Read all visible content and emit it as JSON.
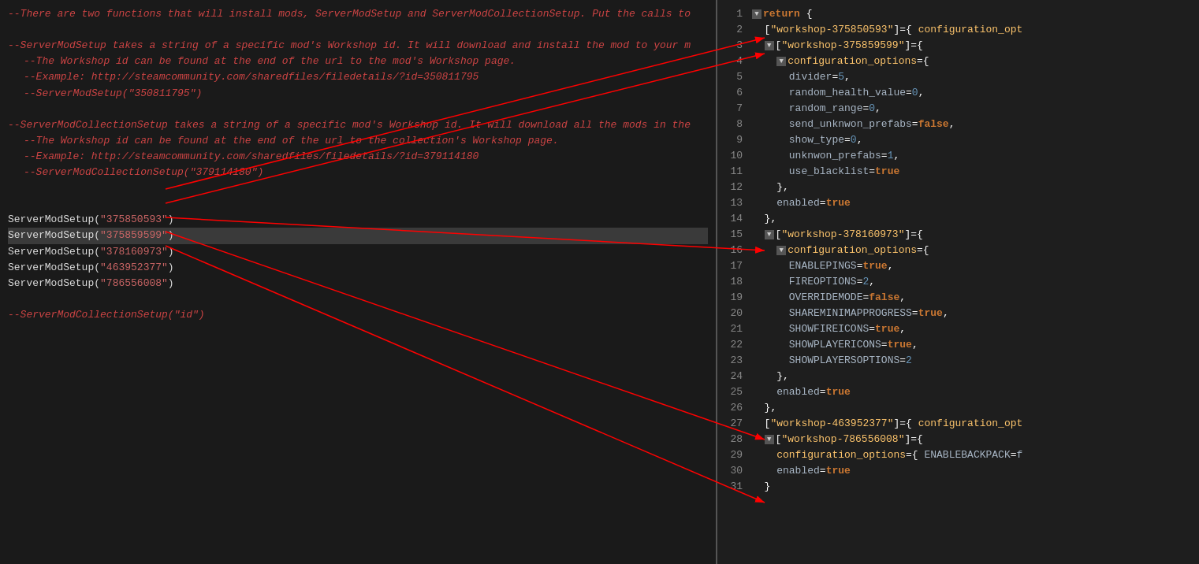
{
  "left_panel": {
    "comments": [
      "--There are two functions that will install mods, ServerModSetup and ServerModCollectionSetup. Put the calls to",
      "",
      "--ServerModSetup takes a string of a specific mod's Workshop id. It will download and install the mod to your m",
      "  --The Workshop id can be found at the end of the url to the mod's Workshop page.",
      "  --Example: http://steamcommunity.com/sharedfiles/filedetails/?id=350811795",
      "  --ServerModSetup(\"350811795\")",
      "",
      "--ServerModCollectionSetup takes a string of a specific mod's Workshop id. It will download all the mods in the",
      "  --The Workshop id can be found at the end of the url to the collection's Workshop page.",
      "  --Example: http://steamcommunity.com/sharedfiles/filedetails/?id=379114180",
      "  --ServerModCollectionSetup(\"379114180\")"
    ],
    "code_lines": [
      "ServerModSetup(\"375850593\")",
      "ServerModSetup(\"375859599\")",
      "ServerModSetup(\"378160973\")",
      "ServerModSetup(\"463952377\")",
      "ServerModSetup(\"786556008\")",
      "",
      "--ServerModCollectionSetup(\"id\")"
    ]
  },
  "right_panel": {
    "lines": [
      {
        "num": 1,
        "content": "return {"
      },
      {
        "num": 2,
        "content": "  [\"workshop-375850593\"]={ configuration_opt"
      },
      {
        "num": 3,
        "content": "  [\"workshop-375859599\"]={"
      },
      {
        "num": 4,
        "content": "    configuration_options={"
      },
      {
        "num": 5,
        "content": "      divider=5,"
      },
      {
        "num": 6,
        "content": "      random_health_value=0,"
      },
      {
        "num": 7,
        "content": "      random_range=0,"
      },
      {
        "num": 8,
        "content": "      send_unknwon_prefabs=false,"
      },
      {
        "num": 9,
        "content": "      show_type=0,"
      },
      {
        "num": 10,
        "content": "      unknwon_prefabs=1,"
      },
      {
        "num": 11,
        "content": "      use_blacklist=true"
      },
      {
        "num": 12,
        "content": "    },"
      },
      {
        "num": 13,
        "content": "    enabled=true"
      },
      {
        "num": 14,
        "content": "  },"
      },
      {
        "num": 15,
        "content": "  [\"workshop-378160973\"]={"
      },
      {
        "num": 16,
        "content": "    configuration_options={"
      },
      {
        "num": 17,
        "content": "      ENABLEPINGS=true,"
      },
      {
        "num": 18,
        "content": "      FIREOPTIONS=2,"
      },
      {
        "num": 19,
        "content": "      OVERRIDEMODE=false,"
      },
      {
        "num": 20,
        "content": "      SHAREMINIMAPPROGRESS=true,"
      },
      {
        "num": 21,
        "content": "      SHOWFIREICONS=true,"
      },
      {
        "num": 22,
        "content": "      SHOWPLAYERICONS=true,"
      },
      {
        "num": 23,
        "content": "      SHOWPLAYERSOPTIONS=2"
      },
      {
        "num": 24,
        "content": "    },"
      },
      {
        "num": 25,
        "content": "    enabled=true"
      },
      {
        "num": 26,
        "content": "  },"
      },
      {
        "num": 27,
        "content": "  [\"workshop-463952377\"]={ configuration_opt"
      },
      {
        "num": 28,
        "content": "  [\"workshop-786556008\"]={"
      },
      {
        "num": 29,
        "content": "    configuration_options={ ENABLEBACKPACK=f"
      },
      {
        "num": 30,
        "content": "    enabled=true"
      },
      {
        "num": 31,
        "content": "  }"
      }
    ]
  },
  "colors": {
    "comment": "#cc4444",
    "keyword": "#cc7832",
    "property": "#a9b7c6",
    "workshop_key": "#ffc66d",
    "number": "#6897bb",
    "background_left": "#1a1a1a",
    "background_right": "#1e1e1e",
    "line_num": "#888888",
    "arrow": "#ff0000"
  }
}
